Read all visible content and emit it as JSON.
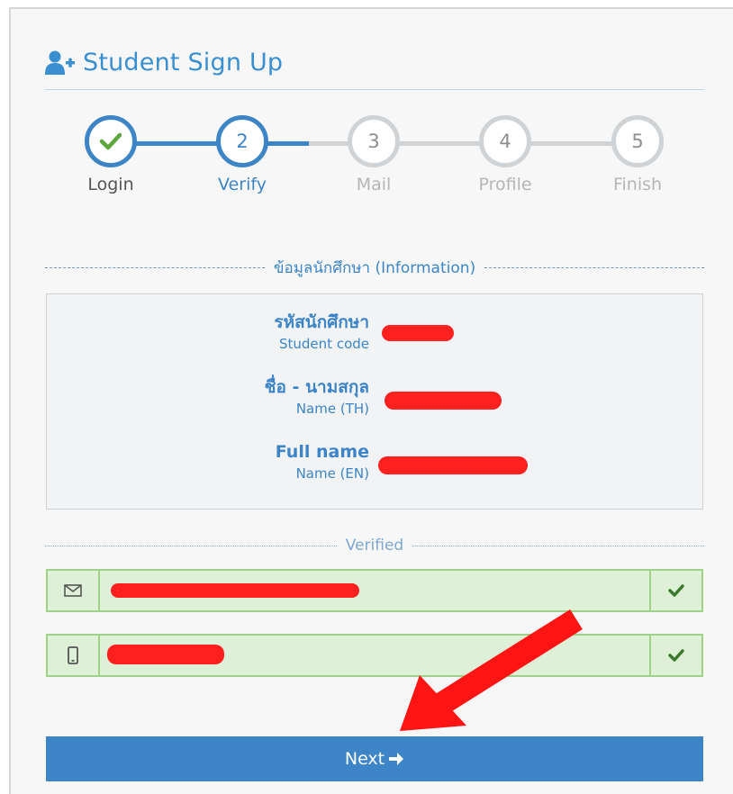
{
  "header": {
    "title": "Student Sign Up",
    "icon": "user-plus-icon"
  },
  "steps": [
    {
      "number": "",
      "label": "Login",
      "state": "done"
    },
    {
      "number": "2",
      "label": "Verify",
      "state": "active"
    },
    {
      "number": "3",
      "label": "Mail",
      "state": "pending"
    },
    {
      "number": "4",
      "label": "Profile",
      "state": "pending"
    },
    {
      "number": "5",
      "label": "Finish",
      "state": "pending"
    }
  ],
  "info_section": {
    "heading": "ข้อมูลนักศึกษา (Information)",
    "rows": [
      {
        "label": "รหัสนักศึกษา",
        "sublabel": "Student code"
      },
      {
        "label": "ชื่อ - นามสกุล",
        "sublabel": "Name (TH)"
      },
      {
        "label": "Full name",
        "sublabel": "Name (EN)"
      }
    ]
  },
  "verified_section": {
    "heading": "Verified",
    "fields": [
      {
        "icon": "envelope-icon",
        "status_icon": "check-icon"
      },
      {
        "icon": "mobile-phone-icon",
        "status_icon": "check-icon"
      }
    ]
  },
  "next_button": {
    "label": "Next"
  },
  "colors": {
    "primary": "#3d85c6",
    "success_bg": "#dff0d8",
    "success_border": "#9fd18a",
    "check_green": "#4e9a3a",
    "redaction": "#ff1414"
  }
}
